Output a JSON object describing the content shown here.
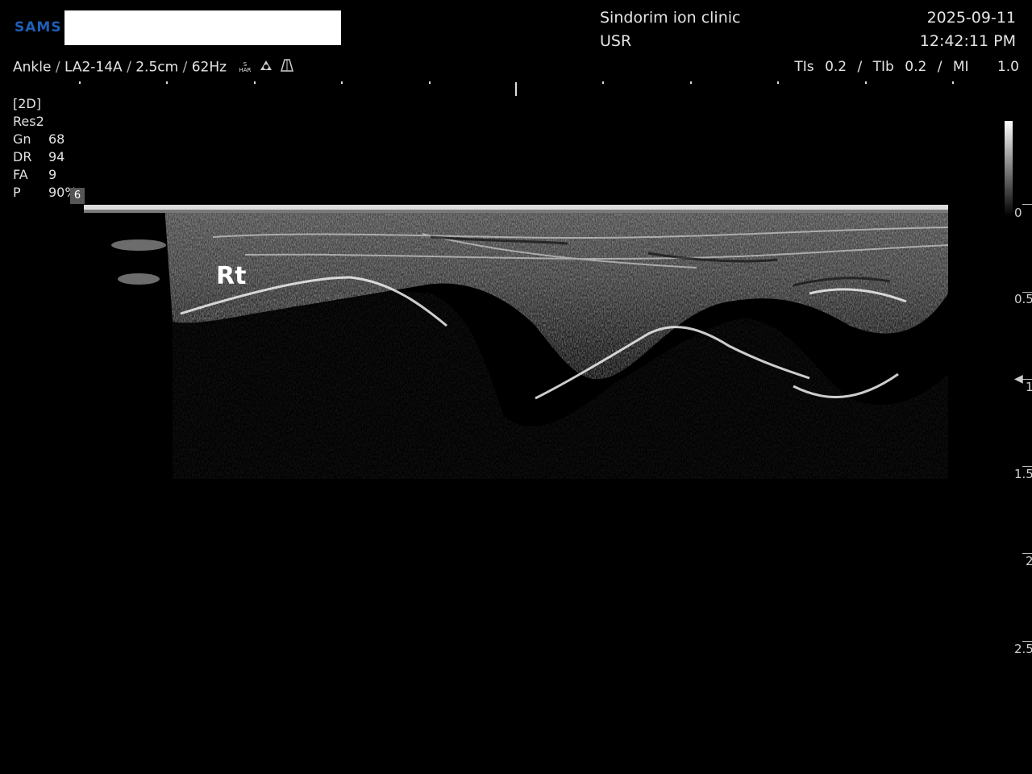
{
  "header": {
    "logo_text": "SAMS",
    "clinic_name": "Sindorim ion clinic",
    "operator": "USR",
    "date": "2025-09-11",
    "time": "12:42:11 PM"
  },
  "probe_bar": {
    "preset": "Ankle",
    "probe": "LA2-14A",
    "depth": "2.5cm",
    "frame_rate": "62Hz",
    "har_top": "S",
    "har_bottom": "HAR"
  },
  "safety": {
    "tis_label": "TIs",
    "tis_value": "0.2",
    "tib_label": "TIb",
    "tib_value": "0.2",
    "mi_label": "MI",
    "mi_value": "1.0"
  },
  "params": {
    "mode": "[2D]",
    "res": "Res2",
    "rows": [
      {
        "label": "Gn",
        "value": "68"
      },
      {
        "label": "DR",
        "value": "94"
      },
      {
        "label": "FA",
        "value": "9"
      },
      {
        "label": "P",
        "value": "90%"
      }
    ],
    "focus_marker": "6"
  },
  "annotation": {
    "side_label": "Rt"
  },
  "depth_scale": {
    "labels": [
      "0",
      "0.5",
      "1",
      "1.5",
      "2",
      "2.5"
    ]
  },
  "icons": [
    "sonoview-icon",
    "probe-shape-icon",
    "focus-marker-icon"
  ]
}
